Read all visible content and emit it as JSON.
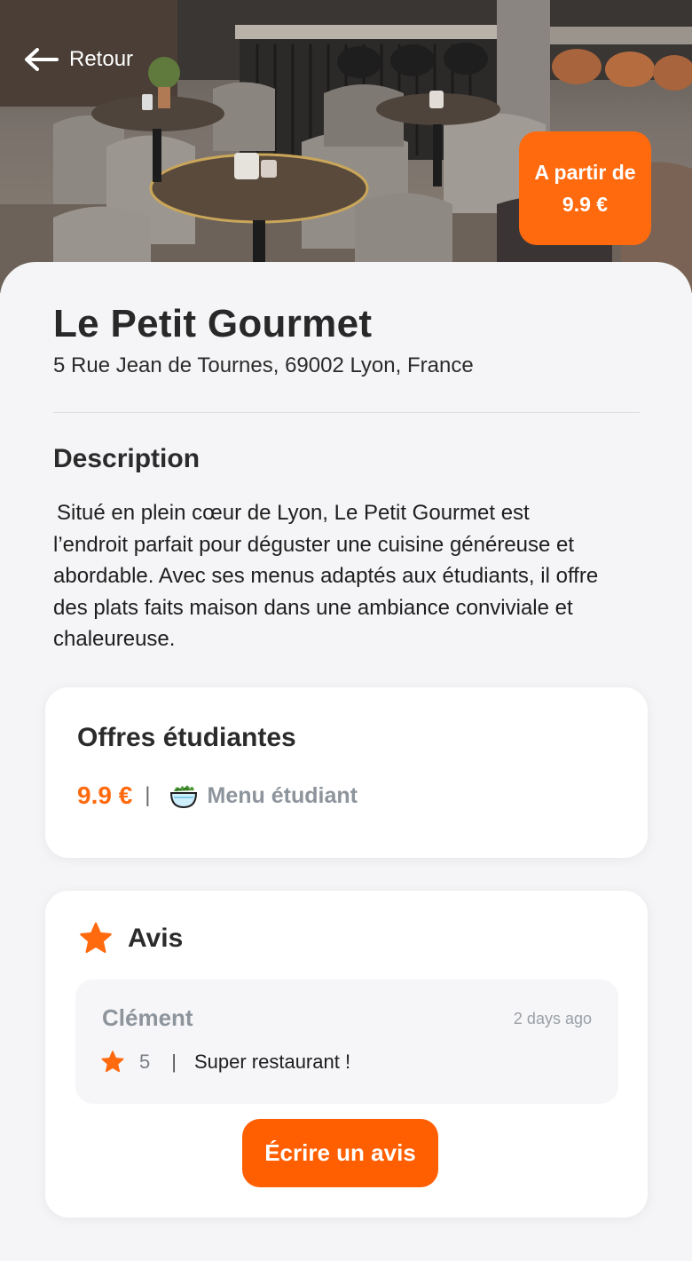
{
  "header": {
    "back_label": "Retour",
    "price_badge_line1": "A partir de",
    "price_badge_line2": "9.9 €"
  },
  "restaurant": {
    "name": "Le Petit Gourmet",
    "address": "5 Rue Jean de Tournes, 69002 Lyon, France"
  },
  "description": {
    "title": "Description",
    "text": "Situé en plein cœur de Lyon, Le Petit Gourmet est l’endroit parfait pour déguster une cuisine généreuse et abordable. Avec ses menus adaptés aux étudiants, il offre des plats faits maison dans une ambiance conviviale et chaleureuse."
  },
  "offers": {
    "title": "Offres étudiantes",
    "items": [
      {
        "price": "9.9 €",
        "separator": "|",
        "icon": "salad-bowl-icon",
        "label": "Menu étudiant"
      }
    ]
  },
  "reviews": {
    "title": "Avis",
    "icon": "star-icon",
    "items": [
      {
        "author": "Clément",
        "time": "2 days ago",
        "rating": "5",
        "separator": "|",
        "text": "Super restaurant !"
      }
    ],
    "write_button": "Écrire un avis"
  },
  "colors": {
    "accent": "#ff6a0f",
    "background": "#f5f5f7",
    "card": "#ffffff",
    "muted_text": "#8d949c"
  }
}
